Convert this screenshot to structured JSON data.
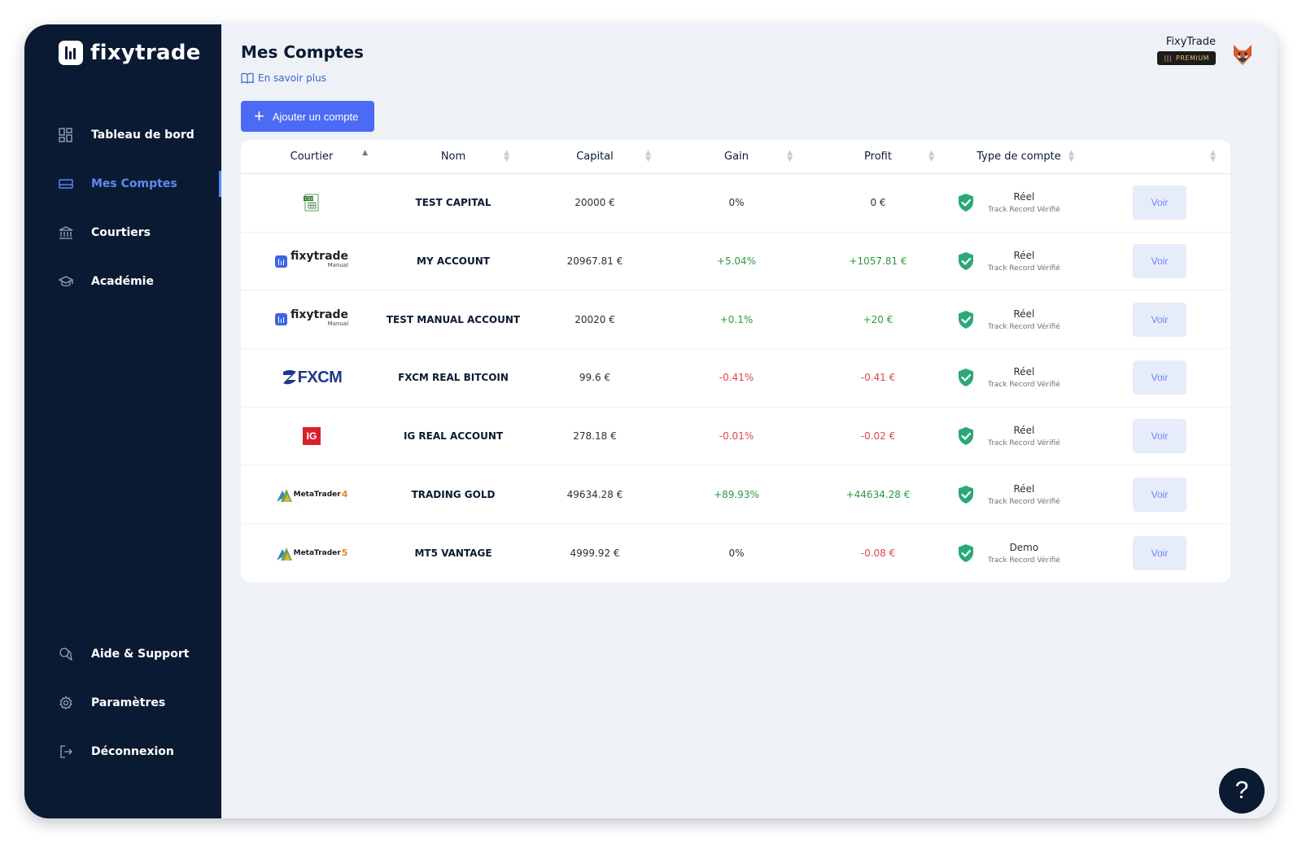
{
  "app": {
    "name": "fixytrade"
  },
  "sidebar": {
    "items": [
      {
        "label": "Tableau de bord",
        "icon": "dashboard-icon"
      },
      {
        "label": "Mes Comptes",
        "icon": "card-icon"
      },
      {
        "label": "Courtiers",
        "icon": "bank-icon"
      },
      {
        "label": "Académie",
        "icon": "graduation-cap-icon"
      }
    ],
    "bottom_items": [
      {
        "label": "Aide & Support",
        "icon": "support-chat-icon"
      },
      {
        "label": "Paramètres",
        "icon": "gear-icon"
      },
      {
        "label": "Déconnexion",
        "icon": "logout-icon"
      }
    ]
  },
  "page": {
    "title": "Mes Comptes",
    "learn_more": "En savoir plus",
    "add_button": "Ajouter un compte"
  },
  "user": {
    "name": "FixyTrade",
    "badge": "PREMIUM"
  },
  "table": {
    "columns": [
      "Courtier",
      "Nom",
      "Capital",
      "Gain",
      "Profit",
      "Type de compte",
      ""
    ],
    "rows": [
      {
        "broker": "csv",
        "name": "TEST CAPITAL",
        "capital": "20000 €",
        "gain": "0%",
        "profit": "0 €",
        "gain_status": "neutral",
        "profit_status": "neutral",
        "type": "Réel",
        "verified": "Track Record Vérifié",
        "action": "Voir"
      },
      {
        "broker": "fixytrade",
        "name": "MY ACCOUNT",
        "capital": "20967.81 €",
        "gain": "+5.04%",
        "profit": "+1057.81 €",
        "gain_status": "pos",
        "profit_status": "pos",
        "type": "Réel",
        "verified": "Track Record Vérifié",
        "action": "Voir"
      },
      {
        "broker": "fixytrade",
        "name": "TEST MANUAL ACCOUNT",
        "capital": "20020 €",
        "gain": "+0.1%",
        "profit": "+20 €",
        "gain_status": "pos",
        "profit_status": "pos",
        "type": "Réel",
        "verified": "Track Record Vérifié",
        "action": "Voir"
      },
      {
        "broker": "fxcm",
        "name": "FXCM REAL BITCOIN",
        "capital": "99.6 €",
        "gain": "-0.41%",
        "profit": "-0.41 €",
        "gain_status": "neg",
        "profit_status": "neg",
        "type": "Réel",
        "verified": "Track Record Vérifié",
        "action": "Voir"
      },
      {
        "broker": "ig",
        "name": "IG REAL ACCOUNT",
        "capital": "278.18 €",
        "gain": "-0.01%",
        "profit": "-0.02 €",
        "gain_status": "neg",
        "profit_status": "neg",
        "type": "Réel",
        "verified": "Track Record Vérifié",
        "action": "Voir"
      },
      {
        "broker": "mt4",
        "name": "TRADING GOLD",
        "capital": "49634.28 €",
        "gain": "+89.93%",
        "profit": "+44634.28 €",
        "gain_status": "pos",
        "profit_status": "pos",
        "type": "Réel",
        "verified": "Track Record Vérifié",
        "action": "Voir"
      },
      {
        "broker": "mt5",
        "name": "MT5 VANTAGE",
        "capital": "4999.92 €",
        "gain": "0%",
        "profit": "-0.08 €",
        "gain_status": "neutral",
        "profit_status": "neg",
        "type": "Demo",
        "verified": "Track Record Vérifié",
        "action": "Voir"
      }
    ]
  },
  "broker_logos": {
    "fixytrade": {
      "word": "fixytrade",
      "sub": "Manual"
    },
    "fxcm": {
      "word": "FXCM"
    },
    "ig": {
      "word": "IG"
    },
    "mt4": {
      "word": "MetaTrader",
      "num": "4"
    },
    "mt5": {
      "word": "MetaTrader",
      "num": "5"
    },
    "csv": {
      "word": "CSV"
    }
  },
  "help": {
    "label": "?"
  },
  "colors": {
    "sidebar": "#0b1a33",
    "accent": "#4b6bf5",
    "positive": "#2d9a3e",
    "negative": "#e04545",
    "verified": "#2aa876"
  }
}
